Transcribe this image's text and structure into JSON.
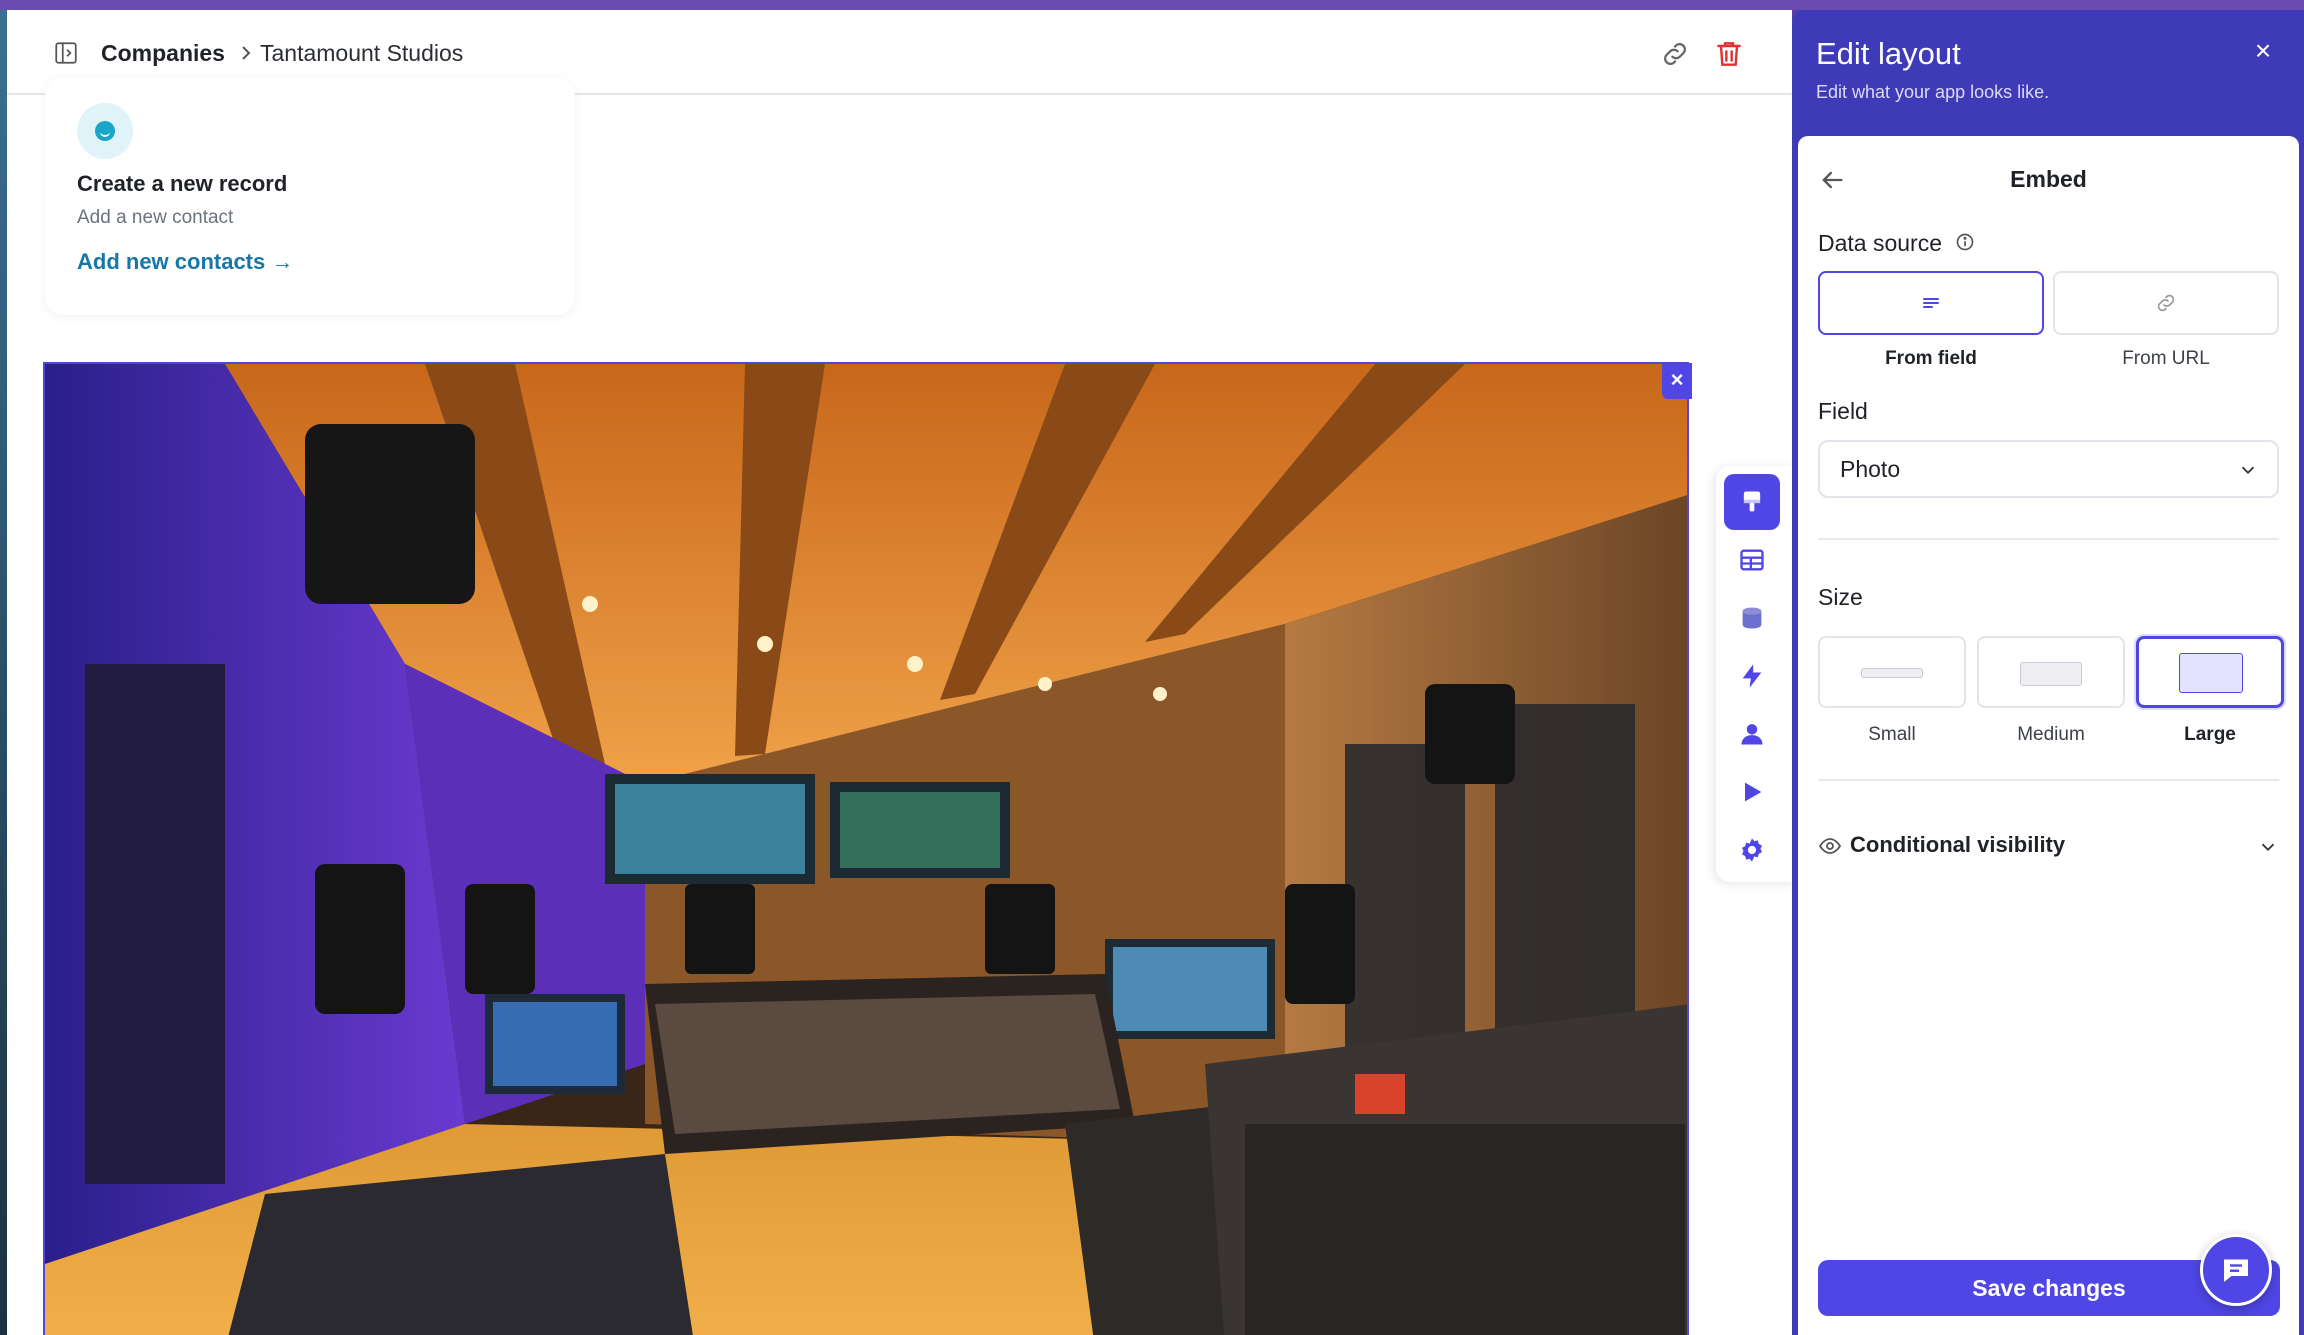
{
  "header": {
    "breadcrumb": [
      "Companies",
      "Tantamount Studios"
    ]
  },
  "card": {
    "title": "Create a new record",
    "subtitle": "Add a new contact",
    "link": "Add new contacts →"
  },
  "embed": {
    "image_alt": "recording-studio-photo",
    "close_label": "×"
  },
  "rail": {
    "items": [
      "paint-brush-icon",
      "table-icon",
      "database-icon",
      "bolt-icon",
      "user-icon",
      "play-icon",
      "gear-icon"
    ]
  },
  "panel": {
    "title": "Edit layout",
    "subtitle": "Edit what your app looks like.",
    "close_label": "×",
    "section_title": "Embed",
    "data_source_label": "Data source",
    "data_source_options": [
      "From field",
      "From URL"
    ],
    "data_source_selected": "From field",
    "field_label": "Field",
    "field_value": "Photo",
    "size_label": "Size",
    "size_options": [
      "Small",
      "Medium",
      "Large"
    ],
    "size_selected": "Large",
    "conditional_label": "Conditional visibility",
    "save_label": "Save changes"
  },
  "colors": {
    "accent": "#4f46e5",
    "panel_header": "#3f3bb8",
    "link": "#1677a8",
    "danger": "#e03131"
  }
}
